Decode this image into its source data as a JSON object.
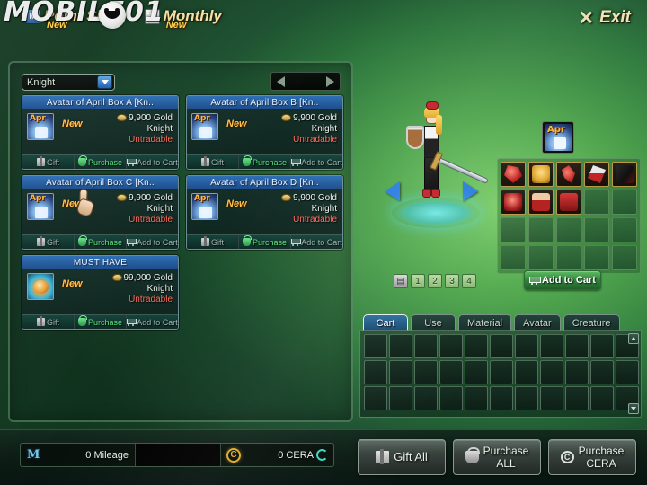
{
  "watermark": {
    "text": "MOBILE01"
  },
  "top_tabs": [
    {
      "label": "Point Shop",
      "badge": "New",
      "icon": "m-point-icon"
    },
    {
      "label": "Monthly",
      "badge": "New",
      "icon": "calendar-icon"
    }
  ],
  "exit": {
    "label": "Exit",
    "icon": "close-x-icon"
  },
  "left_panel": {
    "class_filter": {
      "value": "Knight"
    },
    "pager": {
      "prev_icon": "left-arrow-icon",
      "next_icon": "right-arrow-icon"
    },
    "card_buttons": {
      "gift": "Gift",
      "purchase": "Purchase",
      "add_to_cart": "Add to Cart"
    },
    "cards": [
      {
        "title": "Avatar of April Box A [Kn..",
        "badge": "New",
        "price": "9,900 Gold",
        "job": "Knight",
        "trade": "Untradable",
        "thumb": "april-box-icon"
      },
      {
        "title": "Avatar of April Box B [Kn..",
        "badge": "New",
        "price": "9,900 Gold",
        "job": "Knight",
        "trade": "Untradable",
        "thumb": "april-box-icon"
      },
      {
        "title": "Avatar of April Box C [Kn..",
        "badge": "New",
        "price": "9,900 Gold",
        "job": "Knight",
        "trade": "Untradable",
        "thumb": "april-box-icon"
      },
      {
        "title": "Avatar of April Box D [Kn..",
        "badge": "New",
        "price": "9,900 Gold",
        "job": "Knight",
        "trade": "Untradable",
        "thumb": "april-box-icon"
      },
      {
        "title": "MUST HAVE",
        "badge": "New",
        "price": "99,000 Gold",
        "job": "Knight",
        "trade": "Untradable",
        "thumb": "must-have-orb-icon"
      }
    ]
  },
  "preview": {
    "prev_icon": "left-arrow-icon",
    "next_icon": "right-arrow-icon",
    "page_buttons": [
      "1",
      "2",
      "3",
      "4"
    ],
    "page_icon_button": "preset-icon",
    "add_to_cart": "Add to Cart",
    "equipped_item": "april-box-icon",
    "equip_slots": [
      "red-gem",
      "blonde-face",
      "red-horn",
      "white-red-wing",
      "dark-wing",
      "red-hat",
      "red-glove",
      "red-boot",
      "",
      "",
      "",
      "",
      "",
      "",
      "",
      "",
      "",
      "",
      "",
      ""
    ]
  },
  "cart": {
    "tabs": [
      {
        "label": "Cart",
        "active": true
      },
      {
        "label": "Use",
        "active": false
      },
      {
        "label": "Material",
        "active": false
      },
      {
        "label": "Avatar",
        "active": false
      },
      {
        "label": "Creature",
        "active": false
      }
    ],
    "slot_count": 33,
    "scroll_up_icon": "scroll-up-icon",
    "scroll_down_icon": "scroll-down-icon"
  },
  "bottom": {
    "mileage": {
      "icon": "mileage-icon",
      "value": "0 Mileage"
    },
    "cera": {
      "icon": "cera-icon",
      "value": "0 CERA",
      "refresh_icon": "refresh-icon"
    },
    "buttons": [
      {
        "label": "Gift All",
        "icon": "gift-icon",
        "line1": "Gift All",
        "line2": ""
      },
      {
        "label": "Purchase ALL",
        "icon": "bag-icon",
        "line1": "Purchase",
        "line2": "ALL"
      },
      {
        "label": "Purchase CERA",
        "icon": "cera-icon",
        "line1": "Purchase",
        "line2": "CERA"
      }
    ]
  },
  "colors": {
    "accent_blue": "#2e6fb5",
    "green_button": "#2d7f38",
    "untradable_red": "#ff6a5a",
    "new_gold": "#ffc24a"
  }
}
